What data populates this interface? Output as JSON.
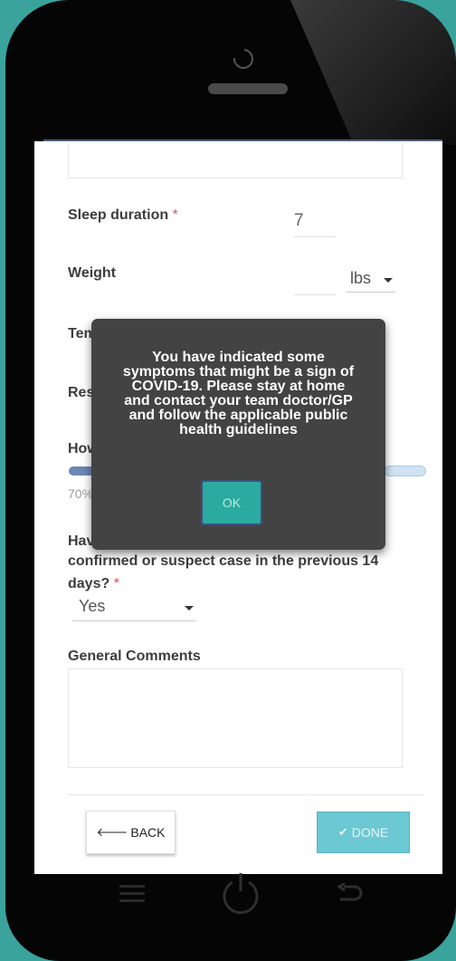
{
  "form": {
    "sleep": {
      "label": "Sleep duration",
      "required": "*",
      "value": "7"
    },
    "weight": {
      "label": "Weight",
      "value": "",
      "unit": "lbs"
    },
    "temperature_label_partial": "Tem",
    "respiratory_label_partial": "Res",
    "how_label_partial": "How",
    "slider": {
      "value_text": "70%",
      "fraction": 0.7
    },
    "contact_question": {
      "partial_first_line": "Hav",
      "line2": "confirmed or suspect case in the previous 14",
      "line3": "days?",
      "required": "*",
      "answer": "Yes"
    },
    "comments": {
      "label": "General Comments",
      "value": ""
    }
  },
  "buttons": {
    "back": {
      "arrow": "🡐",
      "label": "BACK",
      "icon": "arrow-left-icon"
    },
    "done": {
      "check": "✔",
      "label": "DONE",
      "icon": "check-icon"
    }
  },
  "modal": {
    "message": "You have indicated some symptoms that might be a sign of COVID-19. Please stay at home and contact your team doctor/GP and follow the applicable public health guidelines",
    "ok_label": "OK"
  },
  "nav": {
    "menu_icon": "menu-icon",
    "home_icon": "power-home-icon",
    "back_icon": "return-arrow-icon"
  },
  "colors": {
    "accent": "#2bab9f",
    "done": "#6cc8d3",
    "required": "#d9534f",
    "background": "#3aa39b"
  }
}
